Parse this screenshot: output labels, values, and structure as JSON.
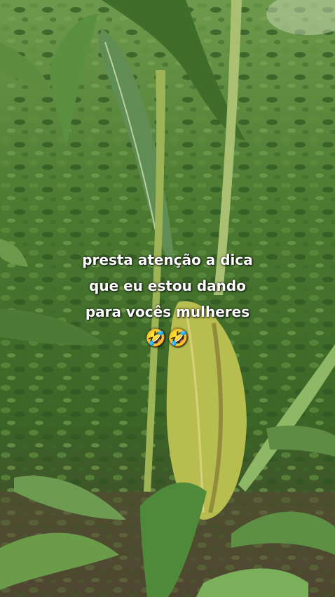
{
  "caption": {
    "line1": "presta atenção a dica",
    "line2": "que eu estou dando",
    "line3": "para vocês mulheres",
    "emoji": "🤣🤣"
  },
  "colors": {
    "foliage_dark": "#2f5420",
    "foliage_mid": "#4f7f35",
    "leaf_light": "#8fb866",
    "husk": "#b7bd4e",
    "soil": "#5a4a35"
  }
}
